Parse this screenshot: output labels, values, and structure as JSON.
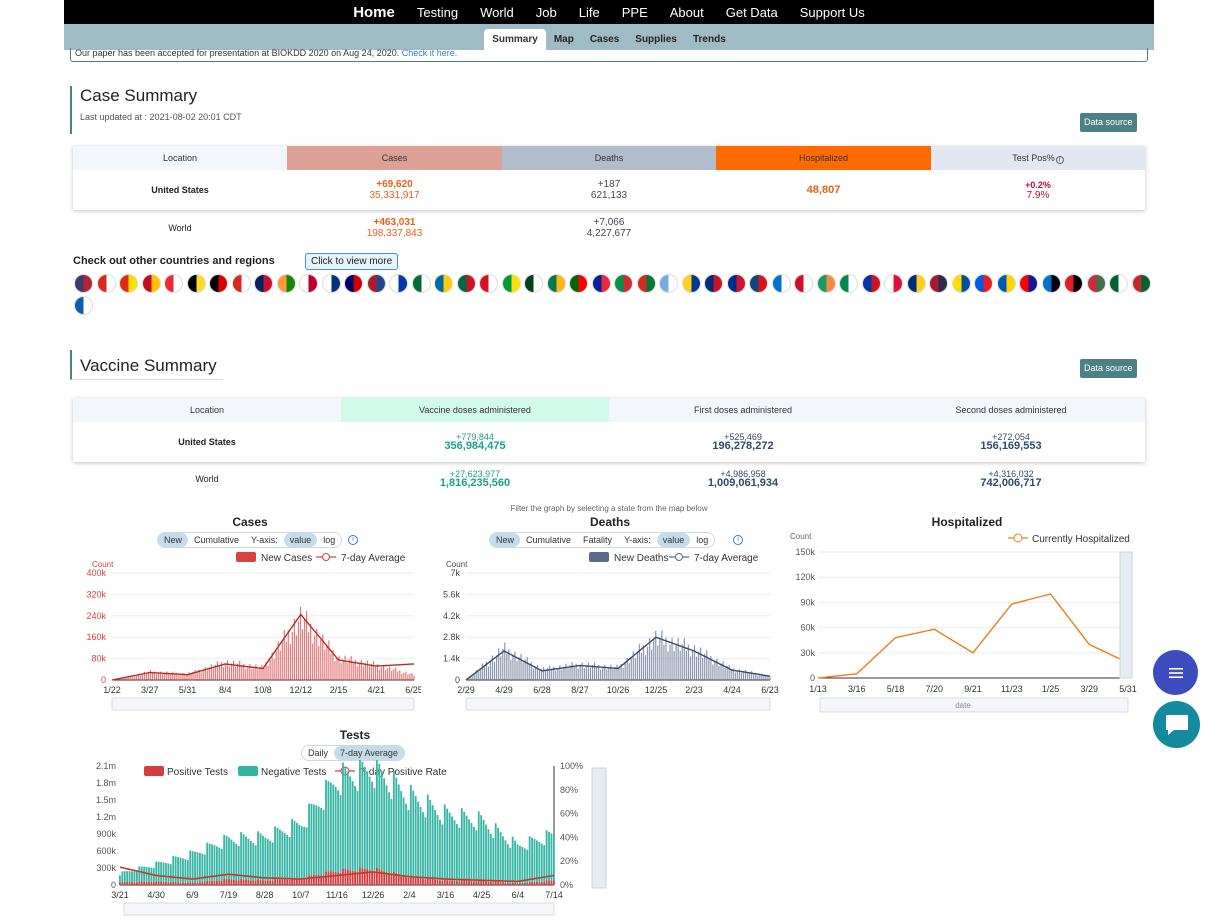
{
  "nav": {
    "items": [
      "Home",
      "Testing",
      "World",
      "Job",
      "Life",
      "PPE",
      "About",
      "Get Data",
      "Support Us"
    ]
  },
  "subnav": {
    "items": [
      "Summary",
      "Map",
      "Cases",
      "Supplies",
      "Trends"
    ]
  },
  "notice": {
    "text": "Our paper has been accepted for presentation at BIOKDD 2020 on Aug 24, 2020.",
    "link": "Check it here."
  },
  "case_summary": {
    "title": "Case Summary",
    "updated": "Last updated at : 2021-08-02 20:01 CDT",
    "data_source": "Data source",
    "headers": [
      "Location",
      "Cases",
      "Deaths",
      "Hospitalized",
      "Test Pos%"
    ],
    "us": {
      "label": "United States",
      "cases_inc": "+69,620",
      "cases_tot": "35,331,917",
      "deaths_inc": "+187",
      "deaths_tot": "621,133",
      "hosp": "48,807",
      "pos_inc": "+0.2%",
      "pos_tot": "7.9%"
    },
    "world": {
      "label": "World",
      "cases_inc": "+463,031",
      "cases_tot": "198,337,843",
      "deaths_inc": "+7,066",
      "deaths_tot": "4,227,677"
    },
    "colors": {
      "cases": "#dca094",
      "deaths": "#b1bccd",
      "hospitalized": "#ff6a00",
      "testpos": "#e3e7f1"
    }
  },
  "countries": {
    "label": "Check out other countries and regions",
    "button": "Click to view more",
    "flags": [
      "usa-flag",
      "canada-flag",
      "china-flag",
      "spain-flag",
      "austria-flag",
      "belgium-flag",
      "germany-flag",
      "switzerland-flag",
      "uk-flag",
      "india-flag",
      "japan-flag",
      "korea-flag",
      "malaysia-flag",
      "netherlands-flag",
      "russia-flag",
      "saudi-flag",
      "sweden-flag",
      "mexico-flag",
      "peru-flag",
      "brazil-flag",
      "pakistan-flag",
      "south-africa-flag",
      "portugal-flag",
      "france-flag",
      "italy-flag",
      "bolivia-flag",
      "argentina-flag",
      "colombia-flag",
      "costa-rica-flag",
      "cuba-flag",
      "czech-flag",
      "honduras-flag",
      "indonesia-flag",
      "ireland-flag",
      "nigeria-flag",
      "philippines-flag",
      "poland-flag",
      "romania-flag",
      "thailand-flag",
      "ecuador-flag",
      "slovenia-flag",
      "ukraine-flag",
      "croatia-flag",
      "estonia-flag",
      "albania-flag",
      "hungary-flag",
      "algeria-flag",
      "morocco-flag",
      "greece-flag"
    ],
    "flag_colors": [
      [
        "#3c3b6e",
        "#b22234"
      ],
      [
        "#d52b1e",
        "#fff"
      ],
      [
        "#de2910",
        "#ffde00"
      ],
      [
        "#c60b1e",
        "#ffc400"
      ],
      [
        "#ed2939",
        "#fff"
      ],
      [
        "#000",
        "#fdda24"
      ],
      [
        "#000",
        "#dd0000"
      ],
      [
        "#d52b1e",
        "#fff"
      ],
      [
        "#012169",
        "#c8102e"
      ],
      [
        "#ff9933",
        "#138808"
      ],
      [
        "#fff",
        "#bc002d"
      ],
      [
        "#fff",
        "#003478"
      ],
      [
        "#010066",
        "#cc0001"
      ],
      [
        "#ae1c28",
        "#21468b"
      ],
      [
        "#fff",
        "#0039a6"
      ],
      [
        "#006c35",
        "#fff"
      ],
      [
        "#006aa7",
        "#fecc00"
      ],
      [
        "#006847",
        "#ce1126"
      ],
      [
        "#d91023",
        "#fff"
      ],
      [
        "#009c3b",
        "#ffdf00"
      ],
      [
        "#01411c",
        "#fff"
      ],
      [
        "#007a4d",
        "#ffb612"
      ],
      [
        "#006600",
        "#ff0000"
      ],
      [
        "#002395",
        "#ed2939"
      ],
      [
        "#009246",
        "#ce2b37"
      ],
      [
        "#d52b1e",
        "#007934"
      ],
      [
        "#74acdf",
        "#fff"
      ],
      [
        "#fcd116",
        "#003893"
      ],
      [
        "#002b7f",
        "#ce1126"
      ],
      [
        "#002a8f",
        "#cf142b"
      ],
      [
        "#11457e",
        "#d7141a"
      ],
      [
        "#0073cf",
        "#fff"
      ],
      [
        "#ce1126",
        "#fff"
      ],
      [
        "#169b62",
        "#ff883e"
      ],
      [
        "#008751",
        "#fff"
      ],
      [
        "#0038a8",
        "#ce1126"
      ],
      [
        "#fff",
        "#dc143c"
      ],
      [
        "#002b7f",
        "#fcd116"
      ],
      [
        "#a51931",
        "#2d2a4a"
      ],
      [
        "#ffdd00",
        "#034ea2"
      ],
      [
        "#005ce5",
        "#ed1c24"
      ],
      [
        "#0057b7",
        "#ffd700"
      ],
      [
        "#ff0000",
        "#171796"
      ],
      [
        "#0072ce",
        "#000"
      ],
      [
        "#e41e20",
        "#000"
      ],
      [
        "#cd2a3e",
        "#436f4d"
      ],
      [
        "#006233",
        "#fff"
      ],
      [
        "#c1272d",
        "#006233"
      ],
      [
        "#0d5eaf",
        "#fff"
      ]
    ]
  },
  "vaccine_summary": {
    "title": "Vaccine Summary",
    "data_source": "Data source",
    "headers": [
      "Location",
      "Vaccine doses administered",
      "First doses administered",
      "Second doses administered"
    ],
    "us": {
      "label": "United States",
      "doses_inc": "+779,844",
      "doses_tot": "356,984,475",
      "first_inc": "+525,469",
      "first_tot": "196,278,272",
      "second_inc": "+272,054",
      "second_tot": "156,169,553"
    },
    "world": {
      "label": "World",
      "doses_inc": "+27,623,977",
      "doses_tot": "1,816,235,560",
      "first_inc": "+4,986,958",
      "first_tot": "1,009,061,934",
      "second_inc": "+4,316,032",
      "second_tot": "742,006,717"
    }
  },
  "filter_note": "Filter the graph by selecting a state from the map below",
  "charts": {
    "cases": {
      "title": "Cases",
      "toggles": [
        "New",
        "Cumulative",
        "Y-axis:",
        "value",
        "log"
      ],
      "legend": [
        "New Cases",
        "7-day Average"
      ],
      "ylabel": "Count",
      "yticks": [
        "400k",
        "320k",
        "240k",
        "160k",
        "80k",
        "0"
      ],
      "xticks": [
        "1/22",
        "3/27",
        "5/31",
        "8/4",
        "10/8",
        "12/12",
        "2/15",
        "4/21",
        "6/25"
      ],
      "color": "#d94141"
    },
    "deaths": {
      "title": "Deaths",
      "toggles": [
        "New",
        "Cumulative",
        "Fatality",
        "Y-axis:",
        "value",
        "log"
      ],
      "legend": [
        "New Deaths",
        "7-day Average"
      ],
      "ylabel": "Count",
      "yticks": [
        "7k",
        "5.6k",
        "4.2k",
        "2.8k",
        "1.4k",
        "0"
      ],
      "xticks": [
        "2/29",
        "4/29",
        "6/28",
        "8/27",
        "10/26",
        "12/25",
        "2/23",
        "4/24",
        "6/23"
      ],
      "color": "#5b6b8a"
    },
    "hospitalized": {
      "title": "Hospitalized",
      "legend": [
        "Currently Hospitalized"
      ],
      "ylabel": "Count",
      "yticks": [
        "150k",
        "120k",
        "90k",
        "60k",
        "30k",
        "0"
      ],
      "xticks": [
        "1/13",
        "3/16",
        "5/18",
        "7/20",
        "9/21",
        "11/23",
        "1/25",
        "3/29",
        "5/31"
      ],
      "xlabel": "date",
      "color": "#f07c1a"
    },
    "tests": {
      "title": "Tests",
      "toggles": [
        "Daily",
        "7-day Average"
      ],
      "legend": [
        "Positive Tests",
        "Negative Tests",
        "7-day Positive Rate"
      ],
      "yticks": [
        "2.1m",
        "1.8m",
        "1.5m",
        "1.2m",
        "900k",
        "600k",
        "300k",
        "0"
      ],
      "y2ticks": [
        "100%",
        "80%",
        "60%",
        "40%",
        "20%",
        "0%"
      ],
      "xticks": [
        "3/21",
        "4/30",
        "6/9",
        "7/19",
        "8/28",
        "10/7",
        "11/16",
        "12/26",
        "2/4",
        "3/16",
        "4/25",
        "6/4",
        "7/14"
      ],
      "color_pos": "#d43d3d",
      "color_neg": "#36b5a4"
    }
  },
  "chart_data": [
    {
      "type": "bar",
      "title": "Cases",
      "ylabel": "Count",
      "ylim": [
        0,
        400000
      ],
      "x": [
        "1/22",
        "3/27",
        "5/31",
        "8/4",
        "10/8",
        "12/12",
        "2/15",
        "4/21",
        "6/25"
      ],
      "series": [
        {
          "name": "New Cases",
          "values": [
            0,
            30000,
            22000,
            65000,
            45000,
            230000,
            80000,
            55000,
            20000
          ]
        },
        {
          "name": "7-day Average",
          "values": [
            0,
            28000,
            20000,
            60000,
            43000,
            245000,
            75000,
            52000,
            60000
          ]
        }
      ]
    },
    {
      "type": "bar",
      "title": "Deaths",
      "ylabel": "Count",
      "ylim": [
        0,
        7000
      ],
      "x": [
        "2/29",
        "4/29",
        "6/28",
        "8/27",
        "10/26",
        "12/25",
        "2/23",
        "4/24",
        "6/23"
      ],
      "series": [
        {
          "name": "New Deaths",
          "values": [
            0,
            2000,
            700,
            1000,
            800,
            2700,
            2000,
            700,
            250
          ]
        },
        {
          "name": "7-day Average",
          "values": [
            0,
            1900,
            600,
            950,
            750,
            2800,
            1900,
            650,
            250
          ]
        }
      ]
    },
    {
      "type": "line",
      "title": "Hospitalized",
      "ylabel": "Count",
      "xlabel": "date",
      "ylim": [
        0,
        150000
      ],
      "x": [
        "1/13",
        "3/16",
        "5/18",
        "7/20",
        "9/21",
        "11/23",
        "1/25",
        "3/29",
        "5/31"
      ],
      "series": [
        {
          "name": "Currently Hospitalized",
          "values": [
            0,
            5000,
            48000,
            58000,
            30000,
            88000,
            100000,
            40000,
            18000
          ]
        }
      ]
    },
    {
      "type": "bar",
      "title": "Tests",
      "ylim": [
        0,
        2100000
      ],
      "x": [
        "3/21",
        "4/30",
        "6/9",
        "7/19",
        "8/28",
        "10/7",
        "11/16",
        "12/26",
        "2/4",
        "3/16",
        "4/25",
        "6/4",
        "7/14"
      ],
      "series": [
        {
          "name": "Positive Tests",
          "values": [
            50000,
            60000,
            40000,
            100000,
            80000,
            120000,
            250000,
            280000,
            150000,
            80000,
            70000,
            30000,
            80000
          ]
        },
        {
          "name": "Negative Tests",
          "values": [
            150000,
            300000,
            500000,
            700000,
            750000,
            950000,
            1600000,
            1750000,
            1400000,
            1150000,
            1050000,
            650000,
            800000
          ]
        },
        {
          "name": "7-day Positive Rate",
          "values": [
            15,
            8,
            5,
            9,
            6,
            5,
            8,
            11,
            7,
            5,
            4,
            3,
            8
          ]
        }
      ]
    }
  ]
}
